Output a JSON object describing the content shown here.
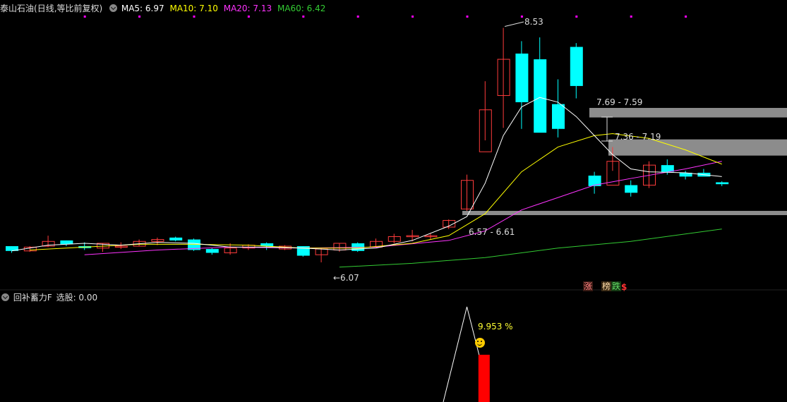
{
  "header": {
    "title": "泰山石油",
    "mode": "(日线,等比前复权)",
    "ma5": "MA5: 6.97",
    "ma10": "MA10: 7.10",
    "ma20": "MA20: 7.13",
    "ma60": "MA60: 6.42",
    "colors": {
      "ma5": "#ffffff",
      "ma10": "#ffff00",
      "ma20": "#ff33ff",
      "ma60": "#33cc33"
    }
  },
  "indicator": {
    "name": "回补蓄力F",
    "value": "选股: 0.00",
    "percent": "9.953 %",
    "smiley_icon": "smiley-face-icon"
  },
  "annotations": {
    "high": "8.53",
    "low": "←6.07",
    "gap1": "7.69 - 7.59",
    "gap2": "7.36 - 7.19",
    "gap3": "6.57 - 6.61",
    "badge_zhang": "涨",
    "badge_bang": "榜",
    "badge_die": "跌",
    "badge_dollar": "$"
  },
  "chart_data": {
    "type": "candlestick",
    "y_range": [
      5.9,
      8.6
    ],
    "candles": [
      [
        6.24,
        6.19,
        6.24,
        6.17
      ],
      [
        6.19,
        6.23,
        6.24,
        6.18
      ],
      [
        6.24,
        6.29,
        6.35,
        6.23
      ],
      [
        6.3,
        6.26,
        6.3,
        6.24
      ],
      [
        6.24,
        6.22,
        6.28,
        6.2
      ],
      [
        6.22,
        6.27,
        6.27,
        6.18
      ],
      [
        6.23,
        6.24,
        6.28,
        6.21
      ],
      [
        6.24,
        6.29,
        6.31,
        6.24
      ],
      [
        6.29,
        6.31,
        6.33,
        6.25
      ],
      [
        6.33,
        6.3,
        6.34,
        6.29
      ],
      [
        6.31,
        6.2,
        6.32,
        6.19
      ],
      [
        6.21,
        6.17,
        6.22,
        6.15
      ],
      [
        6.17,
        6.22,
        6.27,
        6.15
      ],
      [
        6.22,
        6.25,
        6.26,
        6.2
      ],
      [
        6.27,
        6.24,
        6.28,
        6.2
      ],
      [
        6.21,
        6.24,
        6.25,
        6.2
      ],
      [
        6.24,
        6.14,
        6.24,
        6.13
      ],
      [
        6.15,
        6.21,
        6.22,
        6.07
      ],
      [
        6.2,
        6.27,
        6.27,
        6.18
      ],
      [
        6.27,
        6.19,
        6.28,
        6.18
      ],
      [
        6.23,
        6.29,
        6.32,
        6.23
      ],
      [
        6.29,
        6.34,
        6.37,
        6.27
      ],
      [
        6.35,
        6.35,
        6.41,
        6.29
      ],
      [
        6.35,
        6.35,
        6.37,
        6.31
      ],
      [
        6.44,
        6.51,
        6.52,
        6.42
      ],
      [
        6.63,
        6.93,
        6.99,
        6.61
      ],
      [
        7.23,
        7.67,
        7.97,
        7.35
      ],
      [
        7.82,
        8.2,
        8.53,
        7.48
      ],
      [
        8.26,
        7.75,
        8.39,
        7.47
      ],
      [
        8.2,
        7.43,
        8.43,
        7.5
      ],
      [
        7.73,
        7.47,
        7.99,
        7.38
      ],
      [
        8.33,
        7.92,
        8.37,
        7.79
      ],
      [
        6.98,
        6.87,
        7.02,
        6.79
      ],
      [
        6.88,
        7.13,
        7.28,
        7.03
      ],
      [
        6.88,
        6.8,
        6.93,
        6.76
      ],
      [
        6.88,
        7.09,
        7.13,
        6.85
      ],
      [
        7.09,
        7.02,
        7.15,
        6.99
      ],
      [
        7.01,
        6.97,
        7.03,
        6.94
      ],
      [
        7.01,
        6.97,
        7.05,
        6.98
      ],
      [
        6.91,
        6.89,
        6.92,
        6.87
      ]
    ],
    "ma5": [
      [
        0,
        6.19
      ],
      [
        2,
        6.25
      ],
      [
        4,
        6.27
      ],
      [
        6,
        6.25
      ],
      [
        8,
        6.28
      ],
      [
        10,
        6.27
      ],
      [
        12,
        6.23
      ],
      [
        14,
        6.23
      ],
      [
        16,
        6.22
      ],
      [
        18,
        6.2
      ],
      [
        20,
        6.22
      ],
      [
        22,
        6.3
      ],
      [
        24,
        6.45
      ],
      [
        25,
        6.55
      ],
      [
        26,
        6.9
      ],
      [
        27,
        7.4
      ],
      [
        28,
        7.7
      ],
      [
        29,
        7.8
      ],
      [
        30,
        7.75
      ],
      [
        31,
        7.6
      ],
      [
        32,
        7.4
      ],
      [
        33,
        7.2
      ],
      [
        34,
        7.05
      ],
      [
        35,
        7.02
      ],
      [
        37,
        7.01
      ],
      [
        39,
        6.97
      ]
    ],
    "ma10": [
      [
        1,
        6.2
      ],
      [
        4,
        6.23
      ],
      [
        7,
        6.26
      ],
      [
        10,
        6.26
      ],
      [
        13,
        6.25
      ],
      [
        16,
        6.22
      ],
      [
        19,
        6.22
      ],
      [
        22,
        6.27
      ],
      [
        24,
        6.35
      ],
      [
        26,
        6.58
      ],
      [
        28,
        7.02
      ],
      [
        30,
        7.28
      ],
      [
        32,
        7.4
      ],
      [
        33,
        7.42
      ],
      [
        35,
        7.37
      ],
      [
        37,
        7.25
      ],
      [
        39,
        7.1
      ]
    ],
    "ma20": [
      [
        4,
        6.15
      ],
      [
        8,
        6.2
      ],
      [
        12,
        6.23
      ],
      [
        16,
        6.22
      ],
      [
        20,
        6.23
      ],
      [
        24,
        6.3
      ],
      [
        26,
        6.4
      ],
      [
        28,
        6.62
      ],
      [
        30,
        6.75
      ],
      [
        32,
        6.88
      ],
      [
        34,
        6.95
      ],
      [
        37,
        7.05
      ],
      [
        39,
        7.13
      ]
    ],
    "ma60": [
      [
        18,
        6.02
      ],
      [
        22,
        6.06
      ],
      [
        26,
        6.12
      ],
      [
        30,
        6.22
      ],
      [
        34,
        6.29
      ],
      [
        39,
        6.42
      ]
    ],
    "gap_zones": [
      [
        7.59,
        7.69
      ],
      [
        7.19,
        7.36
      ],
      [
        6.57,
        6.61
      ]
    ],
    "indicator_line": [
      [
        24,
        0
      ],
      [
        25,
        1
      ],
      [
        26,
        0
      ]
    ],
    "indicator_bar": {
      "index": 26,
      "value": 9.953
    }
  }
}
